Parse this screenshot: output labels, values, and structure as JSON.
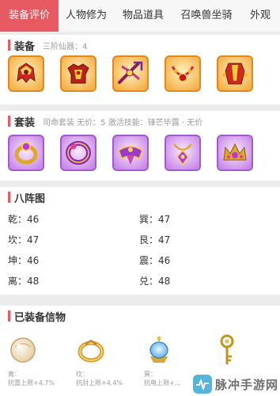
{
  "tabs": [
    {
      "label": "装备评价",
      "active": true
    },
    {
      "label": "人物修为",
      "active": false
    },
    {
      "label": "物品道具",
      "active": false
    },
    {
      "label": "召唤兽坐骑",
      "active": false
    },
    {
      "label": "外观",
      "active": false
    }
  ],
  "equipment": {
    "title": "装备",
    "subtitle": "三阶仙器：4",
    "items": [
      {
        "icon": "golden-helmet-icon"
      },
      {
        "icon": "golden-armor-icon"
      },
      {
        "icon": "crossbow-weapon-icon"
      },
      {
        "icon": "golden-necklace-icon"
      },
      {
        "icon": "red-robe-icon"
      }
    ]
  },
  "set": {
    "title": "套装",
    "subtitle": "司命套装   无价：5   激活技能：锋芒毕露 · 无价",
    "items": [
      {
        "icon": "purple-ring-icon"
      },
      {
        "icon": "purple-bracelet-icon"
      },
      {
        "icon": "purple-belt-icon"
      },
      {
        "icon": "purple-pendant-icon"
      },
      {
        "icon": "purple-crown-icon"
      }
    ]
  },
  "bagua": {
    "title": "八阵图",
    "rows": [
      {
        "left": "乾：46",
        "right": "巽：47"
      },
      {
        "left": "坎：47",
        "right": "艮：47"
      },
      {
        "left": "坤：46",
        "right": "震：46"
      },
      {
        "left": "离：48",
        "right": "兑：48"
      }
    ]
  },
  "xinwu": {
    "title": "已装备信物",
    "items": [
      {
        "icon": "pearl-orb-icon",
        "line1": "离：",
        "line2": "抗雷上限+4.7%"
      },
      {
        "icon": "gold-ring-icon",
        "line1": "坎：",
        "line2": "抗封上限+4.4%"
      },
      {
        "icon": "crystal-lamp-icon",
        "line1": "巽：",
        "line2": "抗电上限+..."
      },
      {
        "icon": "golden-key-icon",
        "line1": "",
        "line2": ""
      }
    ]
  },
  "watermark": {
    "text": "脉冲手游网"
  },
  "colors": {
    "accent": "#e85a62",
    "equip_frame": "#e8861e",
    "set_frame": "#a35ad0"
  }
}
